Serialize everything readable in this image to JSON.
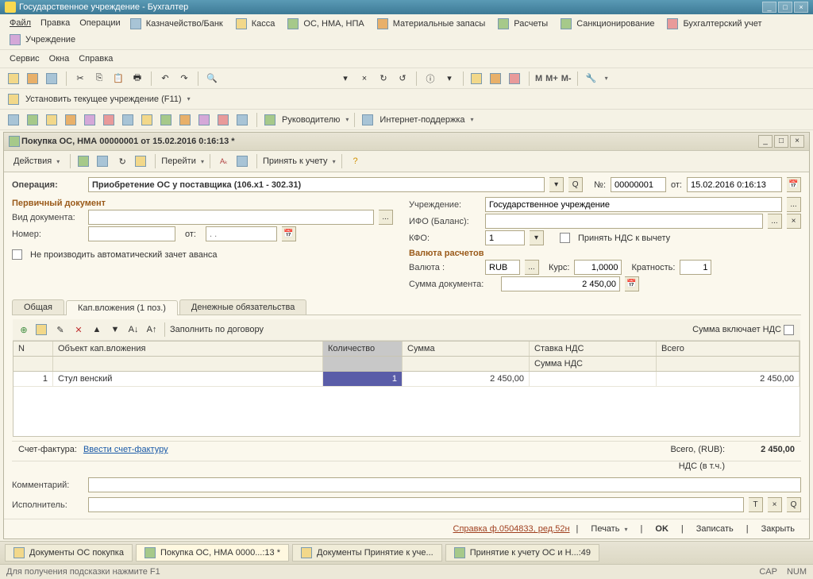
{
  "titlebar": {
    "text": "Государственное учреждение - Бухгалтер"
  },
  "menubar1": {
    "items": [
      "Файл",
      "Правка",
      "Операции",
      "Казначейство/Банк",
      "Касса",
      "ОС, НМА, НПА",
      "Материальные запасы",
      "Расчеты",
      "Санкционирование",
      "Бухгалтерский учет",
      "Учреждение"
    ]
  },
  "menubar2": {
    "items": [
      "Сервис",
      "Окна",
      "Справка"
    ]
  },
  "memory": {
    "m": "M",
    "mplus": "M+",
    "mminus": "M-"
  },
  "setinst": {
    "label": "Установить текущее учреждение (F11)"
  },
  "managers": {
    "ruk": "Руководителю",
    "inet": "Интернет-поддержка"
  },
  "doc": {
    "title": "Покупка ОС, НМА 00000001 от 15.02.2016 0:16:13 *",
    "actions": "Действия",
    "goto": "Перейти",
    "accept": "Принять к учету",
    "op_label": "Операция:",
    "op_value": "Приобретение ОС у поставщика (106.x1 - 302.31)",
    "num_label": "№:",
    "num_value": "00000001",
    "date_label": "от:",
    "date_value": "15.02.2016 0:16:13",
    "section1": "Первичный документ",
    "doctype_label": "Вид документа:",
    "number_label": "Номер:",
    "from_label": "от:",
    "from_placeholder": ". .",
    "noauto": "Не производить автоматический зачет аванса",
    "inst_label": "Учреждение:",
    "inst_value": "Государственное учреждение",
    "ifo_label": "ИФО (Баланс):",
    "kfo_label": "КФО:",
    "kfo_value": "1",
    "nds_deduct": "Принять НДС к вычету",
    "section2": "Валюта расчетов",
    "currency_label": "Валюта :",
    "currency_value": "RUB",
    "rate_label": "Курс:",
    "rate_value": "1,0000",
    "mult_label": "Кратность:",
    "mult_value": "1",
    "sum_label": "Сумма документа:",
    "sum_value": "2 450,00",
    "tabs": [
      "Общая",
      "Кап.вложения (1 поз.)",
      "Денежные обязательства"
    ],
    "fill": "Заполнить по договору",
    "incl_nds": "Сумма включает НДС",
    "grid": {
      "hdrs": [
        "N",
        "Объект кап.вложения",
        "Количество",
        "Сумма",
        "Ставка НДС",
        "Всего"
      ],
      "hdrs2_4": "Сумма НДС",
      "row": {
        "n": "1",
        "obj": "Стул венский",
        "qty": "1",
        "sum": "2 450,00",
        "total": "2 450,00"
      }
    },
    "sf_label": "Счет-фактура:",
    "sf_link": "Ввести счет-фактуру",
    "total_label": "Всего, (RUB):",
    "total_value": "2 450,00",
    "nds_label": "НДС (в т.ч.)",
    "comment_label": "Комментарий:",
    "exec_label": "Исполнитель:",
    "ref": "Справка ф.0504833, ред.52н",
    "print": "Печать",
    "ok": "OK",
    "save": "Записать",
    "close": "Закрыть"
  },
  "taskbar": {
    "tabs": [
      "Документы ОС покупка",
      "Покупка ОС, НМА 0000...:13 *",
      "Документы Принятие к уче...",
      "Принятие к учету ОС и Н...:49"
    ]
  },
  "status": {
    "hint": "Для получения подсказки нажмите F1",
    "cap": "CAP",
    "num": "NUM"
  }
}
